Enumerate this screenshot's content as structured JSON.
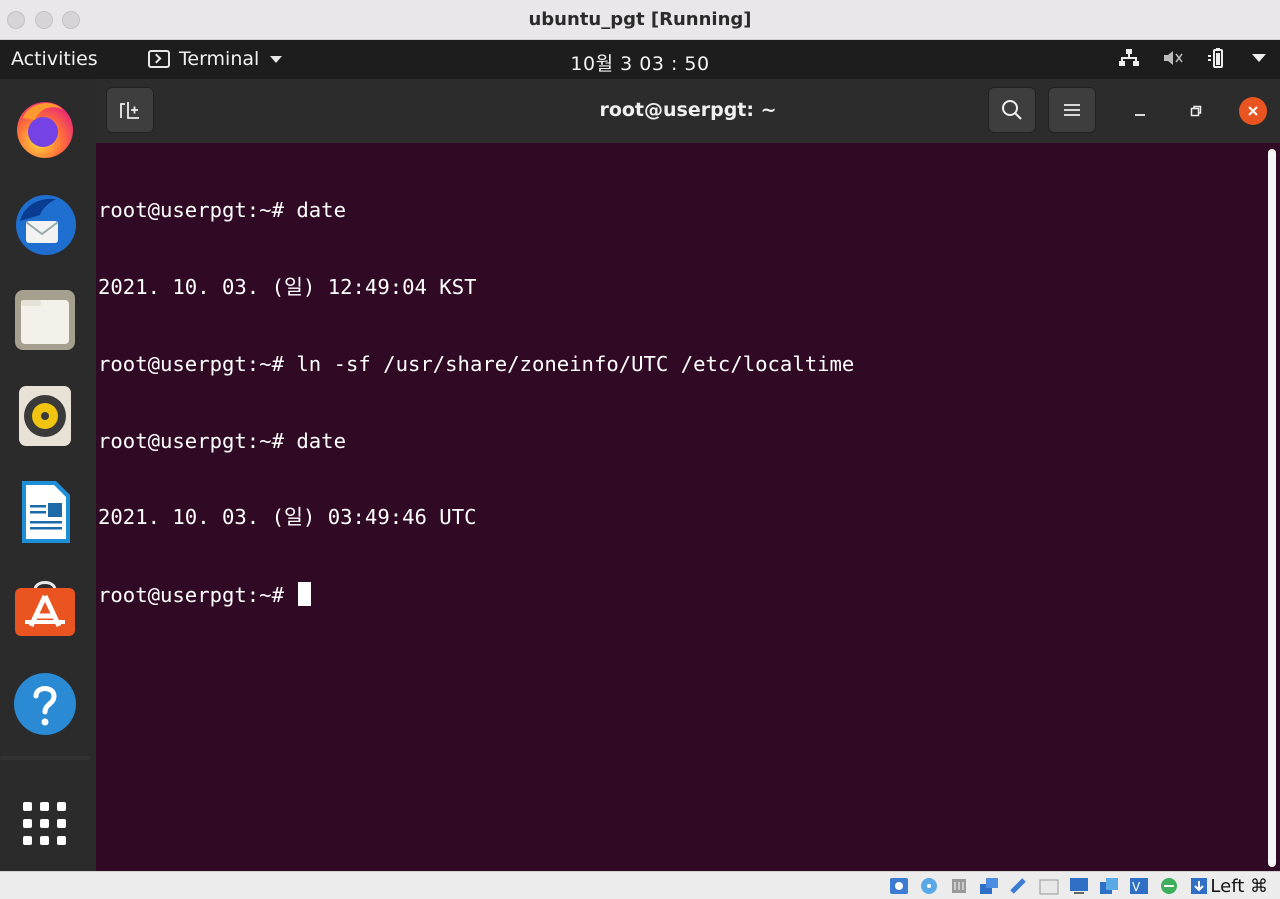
{
  "host_window": {
    "title": "ubuntu_pgt [Running]"
  },
  "top_panel": {
    "activities": "Activities",
    "app_menu": "Terminal",
    "clock": "10월 3  03 : 50"
  },
  "dock": {
    "items": [
      "firefox-icon",
      "thunderbird-icon",
      "files-icon",
      "rhythmbox-icon",
      "libreoffice-writer-icon",
      "ubuntu-software-icon",
      "help-icon",
      "show-apps-icon"
    ]
  },
  "terminal": {
    "title": "root@userpgt: ~",
    "lines": [
      "root@userpgt:~# date",
      "2021. 10. 03. (일) 12:49:04 KST",
      "root@userpgt:~# ln -sf /usr/share/zoneinfo/UTC /etc/localtime",
      "root@userpgt:~# date",
      "2021. 10. 03. (일) 03:49:46 UTC",
      "root@userpgt:~# "
    ]
  },
  "vbox_status": {
    "host_key": "Left ⌘"
  },
  "colors": {
    "terminal_bg": "#300a24",
    "accent": "#e95420",
    "panel_bg": "#1d1d1d",
    "dock_bg": "#2b2b2b"
  }
}
